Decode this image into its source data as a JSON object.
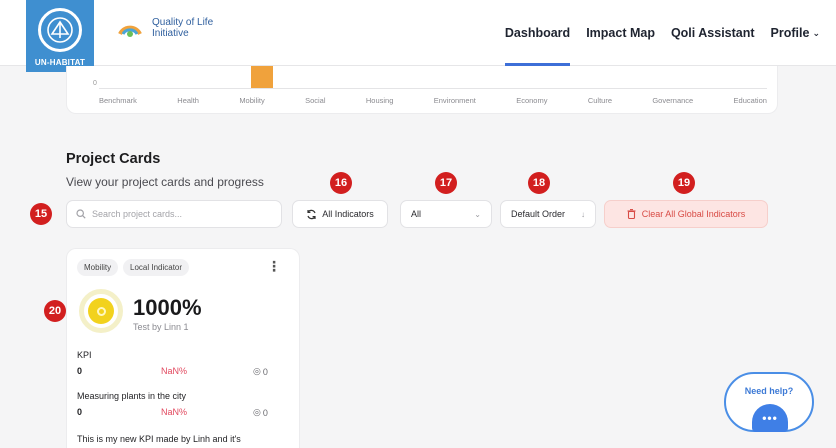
{
  "header": {
    "un_logo_text": "UN-HABITAT",
    "qol_logo_line1": "Quality of Life",
    "qol_logo_line2": "Initiative",
    "nav": [
      {
        "label": "Dashboard",
        "active": true
      },
      {
        "label": "Impact Map",
        "active": false
      },
      {
        "label": "Qoli Assistant",
        "active": false
      },
      {
        "label": "Profile",
        "active": false
      }
    ]
  },
  "chart": {
    "zero_label": "0",
    "categories": [
      "Benchmark",
      "Health",
      "Mobility",
      "Social",
      "Housing",
      "Environment",
      "Economy",
      "Culture",
      "Governance",
      "Education"
    ],
    "highlight_color": "#f0a23c"
  },
  "section": {
    "title": "Project Cards",
    "subtitle": "View your project cards and progress"
  },
  "toolbar": {
    "search_placeholder": "Search project cards...",
    "indicators_label": "All Indicators",
    "filter_label": "All",
    "order_label": "Default Order",
    "clear_label": "Clear All Global Indicators"
  },
  "markers": {
    "m15": "15",
    "m16": "16",
    "m17": "17",
    "m18": "18",
    "m19": "19",
    "m20": "20"
  },
  "card": {
    "tag1": "Mobility",
    "tag2": "Local Indicator",
    "progress_value": "1000%",
    "progress_sub": "Test by Linn 1",
    "kpis": [
      {
        "name": "KPI",
        "value": "0",
        "pct": "NaN%",
        "count": "0"
      },
      {
        "name": "Measuring plants in the city",
        "value": "0",
        "pct": "NaN%",
        "count": "0"
      },
      {
        "name": "This is my new KPI made by Linh and it's",
        "value": "",
        "pct": "",
        "count": ""
      }
    ]
  },
  "help": {
    "label": "Need help?",
    "bubble": "•••"
  },
  "colors": {
    "accent": "#3d6fd8",
    "marker": "#d21f1f",
    "danger": "#d84b45",
    "un_blue": "#3f8fd0"
  }
}
